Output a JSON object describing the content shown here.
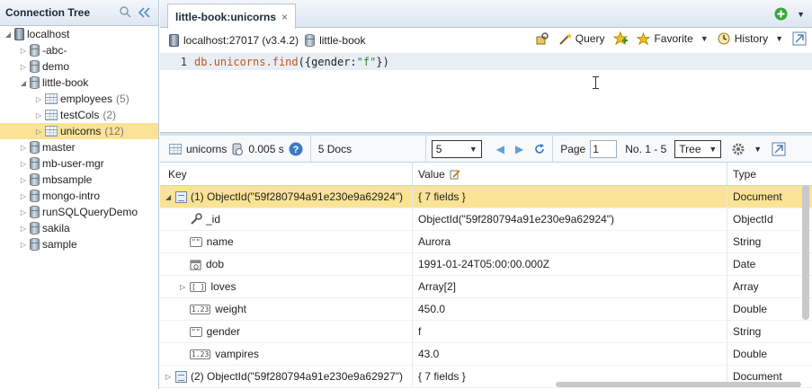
{
  "left": {
    "title": "Connection Tree",
    "nodes": [
      {
        "label": "localhost",
        "count": "",
        "kind": "server",
        "depth": 0,
        "twisty": "expanded"
      },
      {
        "label": "-abc-",
        "count": "",
        "kind": "db",
        "depth": 1,
        "twisty": "collapsed"
      },
      {
        "label": "demo",
        "count": "",
        "kind": "db",
        "depth": 1,
        "twisty": "collapsed"
      },
      {
        "label": "little-book",
        "count": "",
        "kind": "db",
        "depth": 1,
        "twisty": "expanded"
      },
      {
        "label": "employees",
        "count": "(5)",
        "kind": "collection",
        "depth": 2,
        "twisty": "collapsed"
      },
      {
        "label": "testCols",
        "count": "(2)",
        "kind": "collection",
        "depth": 2,
        "twisty": "collapsed"
      },
      {
        "label": "unicorns",
        "count": "(12)",
        "kind": "collection",
        "depth": 2,
        "twisty": "collapsed",
        "selected": true
      },
      {
        "label": "master",
        "count": "",
        "kind": "db",
        "depth": 1,
        "twisty": "collapsed"
      },
      {
        "label": "mb-user-mgr",
        "count": "",
        "kind": "db",
        "depth": 1,
        "twisty": "collapsed"
      },
      {
        "label": "mbsample",
        "count": "",
        "kind": "db",
        "depth": 1,
        "twisty": "collapsed"
      },
      {
        "label": "mongo-intro",
        "count": "",
        "kind": "db",
        "depth": 1,
        "twisty": "collapsed"
      },
      {
        "label": "runSQLQueryDemo",
        "count": "",
        "kind": "db",
        "depth": 1,
        "twisty": "collapsed"
      },
      {
        "label": "sakila",
        "count": "",
        "kind": "db",
        "depth": 1,
        "twisty": "collapsed"
      },
      {
        "label": "sample",
        "count": "",
        "kind": "db",
        "depth": 1,
        "twisty": "collapsed"
      }
    ]
  },
  "tab": {
    "title": "little-book:unicorns",
    "close": "×"
  },
  "connection": {
    "server": "localhost:27017 (v3.4.2)",
    "database": "little-book"
  },
  "toolbar": {
    "query": "Query",
    "favorite": "Favorite",
    "history": "History"
  },
  "editor": {
    "line_number": "1",
    "tokens": [
      {
        "t": "db.",
        "c": "c-obj"
      },
      {
        "t": "unicorns",
        "c": "c-obj"
      },
      {
        "t": ".",
        "c": "c-obj"
      },
      {
        "t": "find",
        "c": "c-obj"
      },
      {
        "t": "({gender:",
        "c": ""
      },
      {
        "t": "\"f\"",
        "c": "c-str"
      },
      {
        "t": "})",
        "c": ""
      }
    ]
  },
  "results_toolbar": {
    "collection": "unicorns",
    "time": "0.005 s",
    "docs": "5 Docs",
    "page_size": "5",
    "page_label": "Page",
    "page_value": "1",
    "range": "No. 1 - 5",
    "view_mode": "Tree"
  },
  "grid": {
    "headers": {
      "key": "Key",
      "value": "Value",
      "type": "Type"
    },
    "rows": [
      {
        "indent": 0,
        "twisty": "expanded",
        "icon": "doc",
        "key": "(1) ObjectId(\"59f280794a91e230e9a62924\")",
        "value": "{ 7 fields }",
        "type": "Document",
        "highlight": true
      },
      {
        "indent": 1,
        "twisty": "",
        "icon": "key",
        "key": "_id",
        "value": "ObjectId(\"59f280794a91e230e9a62924\")",
        "type": "ObjectId"
      },
      {
        "indent": 1,
        "twisty": "",
        "icon": "str",
        "key": "name",
        "value": "Aurora",
        "type": "String"
      },
      {
        "indent": 1,
        "twisty": "",
        "icon": "date",
        "key": "dob",
        "value": "1991-01-24T05:00:00.000Z",
        "type": "Date"
      },
      {
        "indent": 1,
        "twisty": "collapsed",
        "icon": "arr",
        "key": "loves",
        "value": "Array[2]",
        "type": "Array"
      },
      {
        "indent": 1,
        "twisty": "",
        "icon": "num",
        "key": "weight",
        "value": "450.0",
        "type": "Double"
      },
      {
        "indent": 1,
        "twisty": "",
        "icon": "str",
        "key": "gender",
        "value": "f",
        "type": "String"
      },
      {
        "indent": 1,
        "twisty": "",
        "icon": "num",
        "key": "vampires",
        "value": "43.0",
        "type": "Double"
      },
      {
        "indent": 0,
        "twisty": "collapsed",
        "icon": "doc",
        "key": "(2) ObjectId(\"59f280794a91e230e9a62927\")",
        "value": "{ 7 fields }",
        "type": "Document"
      }
    ]
  },
  "icons": {
    "str": "\"\"",
    "num": "1.23",
    "arr": "[ ]"
  }
}
